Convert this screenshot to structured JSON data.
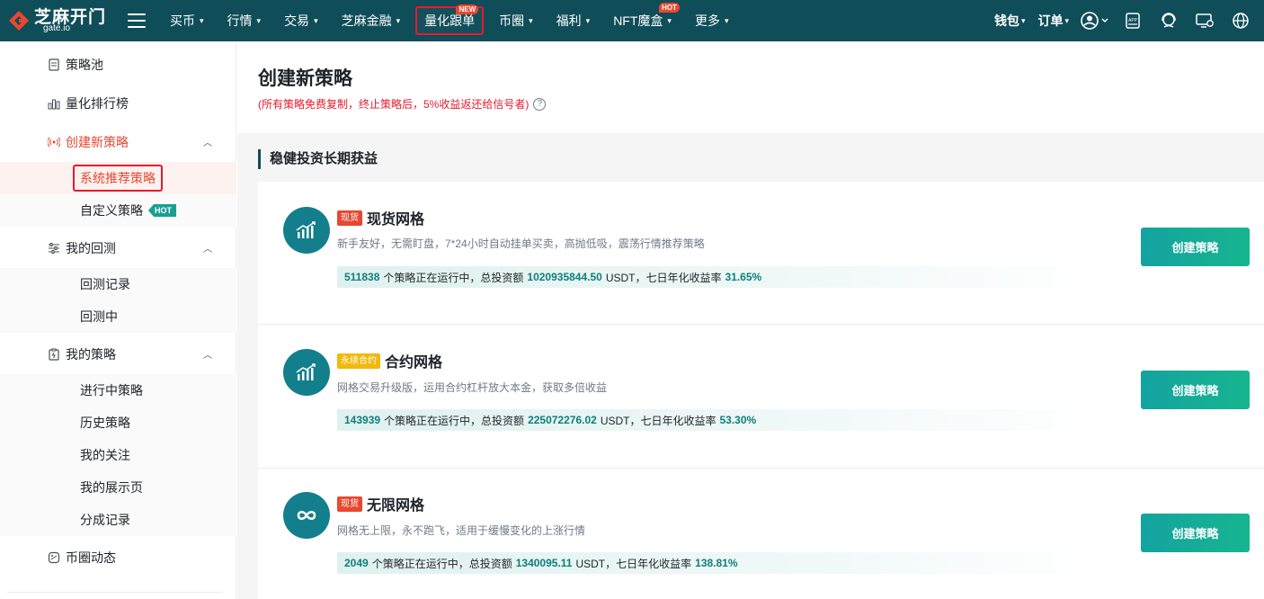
{
  "topnav": {
    "logo_text": "芝麻开门",
    "logo_sub": "gate.io",
    "items": [
      {
        "label": "买币",
        "caret": "▾"
      },
      {
        "label": "行情",
        "caret": "▾"
      },
      {
        "label": "交易",
        "caret": "▾"
      },
      {
        "label": "芝麻金融",
        "caret": "▾"
      },
      {
        "label": "量化跟单",
        "badge": "NEW"
      },
      {
        "label": "币圈",
        "caret": "▾"
      },
      {
        "label": "福利",
        "caret": "▾"
      },
      {
        "label": "NFT魔盒",
        "caret": "▾",
        "badge": "HOT"
      },
      {
        "label": "更多",
        "caret": "▾"
      }
    ],
    "right": {
      "wallet": "钱包",
      "orders": "订单",
      "app_icon_text": "APP"
    }
  },
  "sidebar": {
    "items": [
      {
        "label": "策略池"
      },
      {
        "label": "量化排行榜"
      },
      {
        "label": "创建新策略",
        "arrow": "︿"
      },
      {
        "label": "系统推荐策略"
      },
      {
        "label": "自定义策略",
        "badge": "HOT"
      },
      {
        "label": "我的回测",
        "arrow": "︿"
      },
      {
        "label": "回测记录"
      },
      {
        "label": "回测中"
      },
      {
        "label": "我的策略",
        "arrow": "︿"
      },
      {
        "label": "进行中策略"
      },
      {
        "label": "历史策略"
      },
      {
        "label": "我的关注"
      },
      {
        "label": "我的展示页"
      },
      {
        "label": "分成记录"
      },
      {
        "label": "币圈动态"
      }
    ]
  },
  "main": {
    "title": "创建新策略",
    "subtitle": "(所有策略免费复制，终止策略后，5%收益返还给信号者)",
    "help_icon": "?",
    "section_title": "稳健投资长期获益",
    "cards": [
      {
        "tag": "现货",
        "title": "现货网格",
        "desc": "新手友好，无需盯盘，7*24小时自动挂单买卖，高抛低吸，震荡行情推荐策略",
        "running": "511838",
        "running_text": "个策略正在运行中，总投资额",
        "invest": "1020935844.50",
        "unit_text": "USDT，七日年化收益率",
        "apr": "31.65%",
        "button": "创建策略"
      },
      {
        "tag": "永续合约",
        "title": "合约网格",
        "desc": "网格交易升级版，运用合约杠杆放大本金，获取多倍收益",
        "running": "143939",
        "running_text": "个策略正在运行中，总投资额",
        "invest": "225072276.02",
        "unit_text": "USDT，七日年化收益率",
        "apr": "53.30%",
        "button": "创建策略"
      },
      {
        "tag": "现货",
        "title": "无限网格",
        "desc": "网格无上限，永不跑飞，适用于缓慢变化的上涨行情",
        "running": "2049",
        "running_text": "个策略正在运行中，总投资额",
        "invest": "1340095.11",
        "unit_text": "USDT，七日年化收益率",
        "apr": "138.81%",
        "button": "创建策略"
      }
    ]
  },
  "colors": {
    "nav_bg": "#0f4d59",
    "accent_red": "#e9472f",
    "teal": "#137f8c",
    "button_teal": "#14a3a0"
  }
}
